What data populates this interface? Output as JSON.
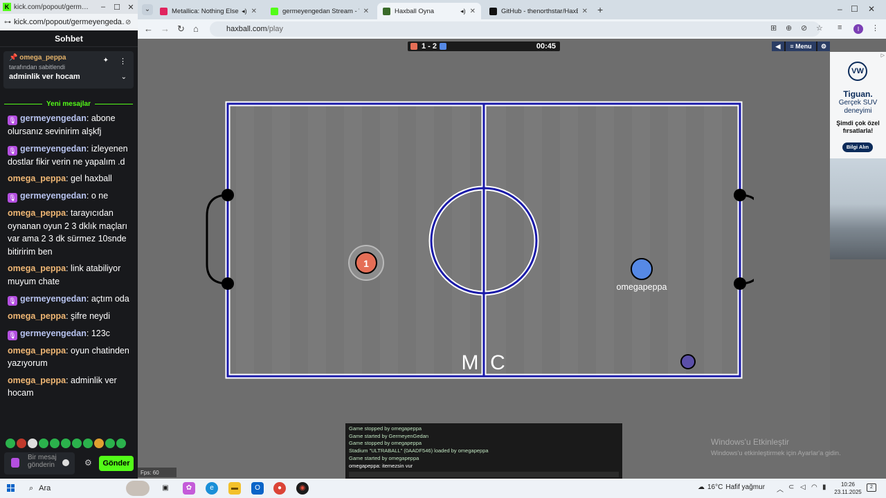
{
  "kick": {
    "window_title": "kick.com/popout/germ…",
    "url": "kick.com/popout/germeyengeda…",
    "header": "Sohbet",
    "pinned": {
      "user": "omega_peppa",
      "by": "tarafından sabitlendi",
      "message": "adminlik ver hocam"
    },
    "new_messages_label": "Yeni mesajlar",
    "messages": [
      {
        "user": "germeyengedan",
        "text": ": abone olursanız sevinirim alşkfj",
        "sub": true
      },
      {
        "user": "germeyengedan",
        "text": ": izleyenen dostlar fikir verin ne yapalım .d",
        "sub": true
      },
      {
        "user": "omega_peppa",
        "text": ": gel haxball",
        "sub": false
      },
      {
        "user": "germeyengedan",
        "text": ": o ne",
        "sub": true
      },
      {
        "user": "omega_peppa",
        "text": ": tarayıcıdan oynanan oyun 2 3 dklık maçları var ama 2 3 dk sürmez 10snde bitiririm ben",
        "sub": false
      },
      {
        "user": "omega_peppa",
        "text": ": link atabiliyor muyum chate",
        "sub": false
      },
      {
        "user": "germeyengedan",
        "text": ": açtım oda",
        "sub": true
      },
      {
        "user": "omega_peppa",
        "text": ": şifre neydi",
        "sub": false
      },
      {
        "user": "germeyengedan",
        "text": ": 123c",
        "sub": true
      },
      {
        "user": "omega_peppa",
        "text": ": oyun chatinden yazıyorum",
        "sub": false
      },
      {
        "user": "omega_peppa",
        "text": ": adminlik ver hocam",
        "sub": false
      }
    ],
    "colors": {
      "germeyengedan": "#b7c3ef",
      "omega_peppa": "#f0b774",
      "accent": "#53fc18"
    },
    "input_placeholder": "Bir mesaj gönderin",
    "send_label": "Gönder"
  },
  "browser": {
    "tabs": [
      {
        "title": "Metallica: Nothing Else Ma",
        "icon": "youtube-icon",
        "color": "#e0245e",
        "audio": true
      },
      {
        "title": "germeyengedan Stream - Watc",
        "icon": "kick-icon",
        "color": "#53fc18",
        "audio": false
      },
      {
        "title": "Haxball Oyna",
        "icon": "haxball-icon",
        "color": "#3a6b2a",
        "audio": true,
        "active": true
      },
      {
        "title": "GitHub - thenorthstar/HaxBall-",
        "icon": "github-icon",
        "color": "#111111",
        "audio": false
      }
    ],
    "url_domain": "haxball.com",
    "url_path": "/play",
    "profile_initial": "I"
  },
  "game": {
    "score": "1 - 2",
    "time": "00:45",
    "menu_label": "Menu",
    "player_red_number": "1",
    "player_blue_name": "omegapeppa",
    "field_text_left": "M",
    "field_text_right": "C",
    "colors": {
      "red": "#e56e56",
      "blue": "#5689e5",
      "line": "#1a1aa8"
    },
    "chat_log": [
      "Game stopped by omegapeppa",
      "Game started by GermeyenGedan",
      "Game stopped by omegapeppa",
      "Stadium \"ULTRABALL\" (0AADF546) loaded by omegapeppa",
      "Game started by omegapeppa",
      "omegapeppa: itemezsin vur"
    ],
    "fps": "Fps: 60"
  },
  "ad": {
    "brand": "VW",
    "model": "Tiguan.",
    "tagline": "Gerçek SUV deneyimi",
    "offer": "Şimdi çok özel fırsatlarla!",
    "button": "Bilgi Alın"
  },
  "overlay": {
    "activate_title": "Windows'u Etkinleştir",
    "activate_sub": "Windows'u etkinleştirmek için Ayarlar'a gidin."
  },
  "taskbar": {
    "search": "Ara",
    "temperature": "16°C",
    "weather": "Hafif yağmur",
    "time": "10:26",
    "date": "23.11.2025"
  }
}
